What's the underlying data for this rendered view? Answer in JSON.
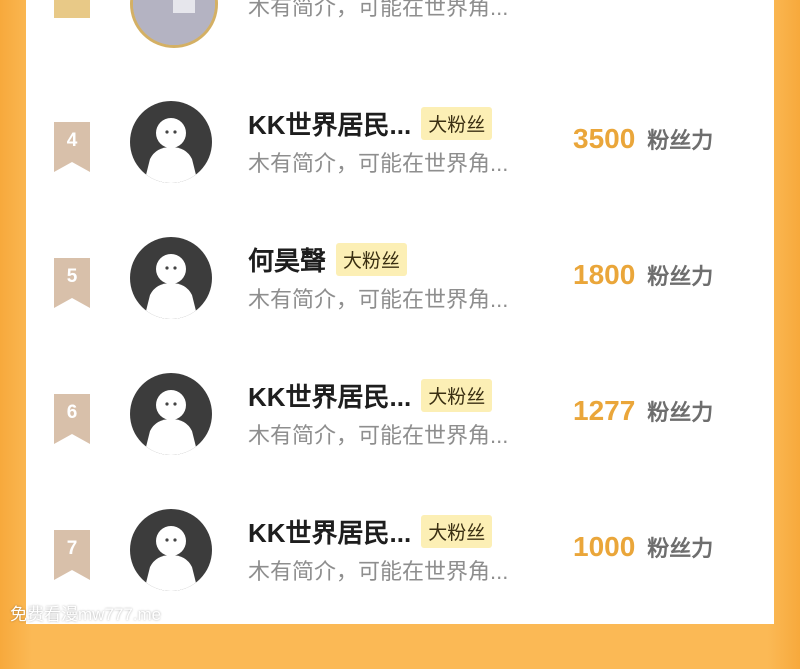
{
  "top_partial": {
    "bio": "木有简介，可能在世界角..."
  },
  "rows": [
    {
      "rank": "4",
      "name": "KK世界居民...",
      "badge": "大粉丝",
      "bio": "木有简介，可能在世界角...",
      "fans": "3500",
      "fans_label": "粉丝力"
    },
    {
      "rank": "5",
      "name": "何昊聲",
      "badge": "大粉丝",
      "bio": "木有简介，可能在世界角...",
      "fans": "1800",
      "fans_label": "粉丝力"
    },
    {
      "rank": "6",
      "name": "KK世界居民...",
      "badge": "大粉丝",
      "bio": "木有简介，可能在世界角...",
      "fans": "1277",
      "fans_label": "粉丝力"
    },
    {
      "rank": "7",
      "name": "KK世界居民...",
      "badge": "大粉丝",
      "bio": "木有简介，可能在世界角...",
      "fans": "1000",
      "fans_label": "粉丝力"
    }
  ],
  "watermark": "免费看漫mw777.me",
  "colors": {
    "accent": "#eaa63a",
    "badge_bg": "#fcefb5",
    "rank_tag": "#d8c0aa",
    "page_bg": "#fbb955"
  }
}
